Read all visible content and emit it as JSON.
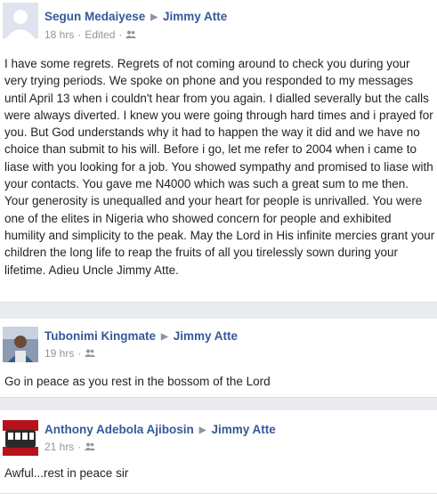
{
  "posts": [
    {
      "author": "Segun Medaiyese",
      "target": "Jimmy Atte",
      "time": "18 hrs",
      "edited": "Edited",
      "text": "I have some regrets. Regrets of not coming around to check you during your very trying periods. We spoke on phone and you responded to my messages until April 13 when i couldn't hear from you again. I dialled severally but the calls were always diverted. I knew you were going through hard times and i prayed for you. But God understands why it had to happen the way it did and we have no choice than submit to his will. Before i go, let me refer to 2004 when i came to liase with you looking for a job. You showed sympathy and promised to liase with your contacts. You gave me N4000 which was such a great sum to me then. Your generosity is unequalled and your heart for people is unrivalled. You were one of the elites in Nigeria who showed concern for people and exhibited humility and simplicity to the peak. May the Lord in His infinite mercies grant your children the long life to reap the fruits of all you tirelessly sown during your lifetime. Adieu Uncle Jimmy Atte."
    },
    {
      "author": "Tubonimi Kingmate",
      "target": "Jimmy Atte",
      "time": "19 hrs",
      "text": "Go in peace as you rest in the bossom of the Lord"
    },
    {
      "author": "Anthony Adebola Ajibosin",
      "target": "Jimmy Atte",
      "time": "21 hrs",
      "text": "Awful...rest in peace sir"
    }
  ],
  "icons": {
    "arrow": "▶",
    "audience": "friends-icon",
    "separator": "·"
  }
}
